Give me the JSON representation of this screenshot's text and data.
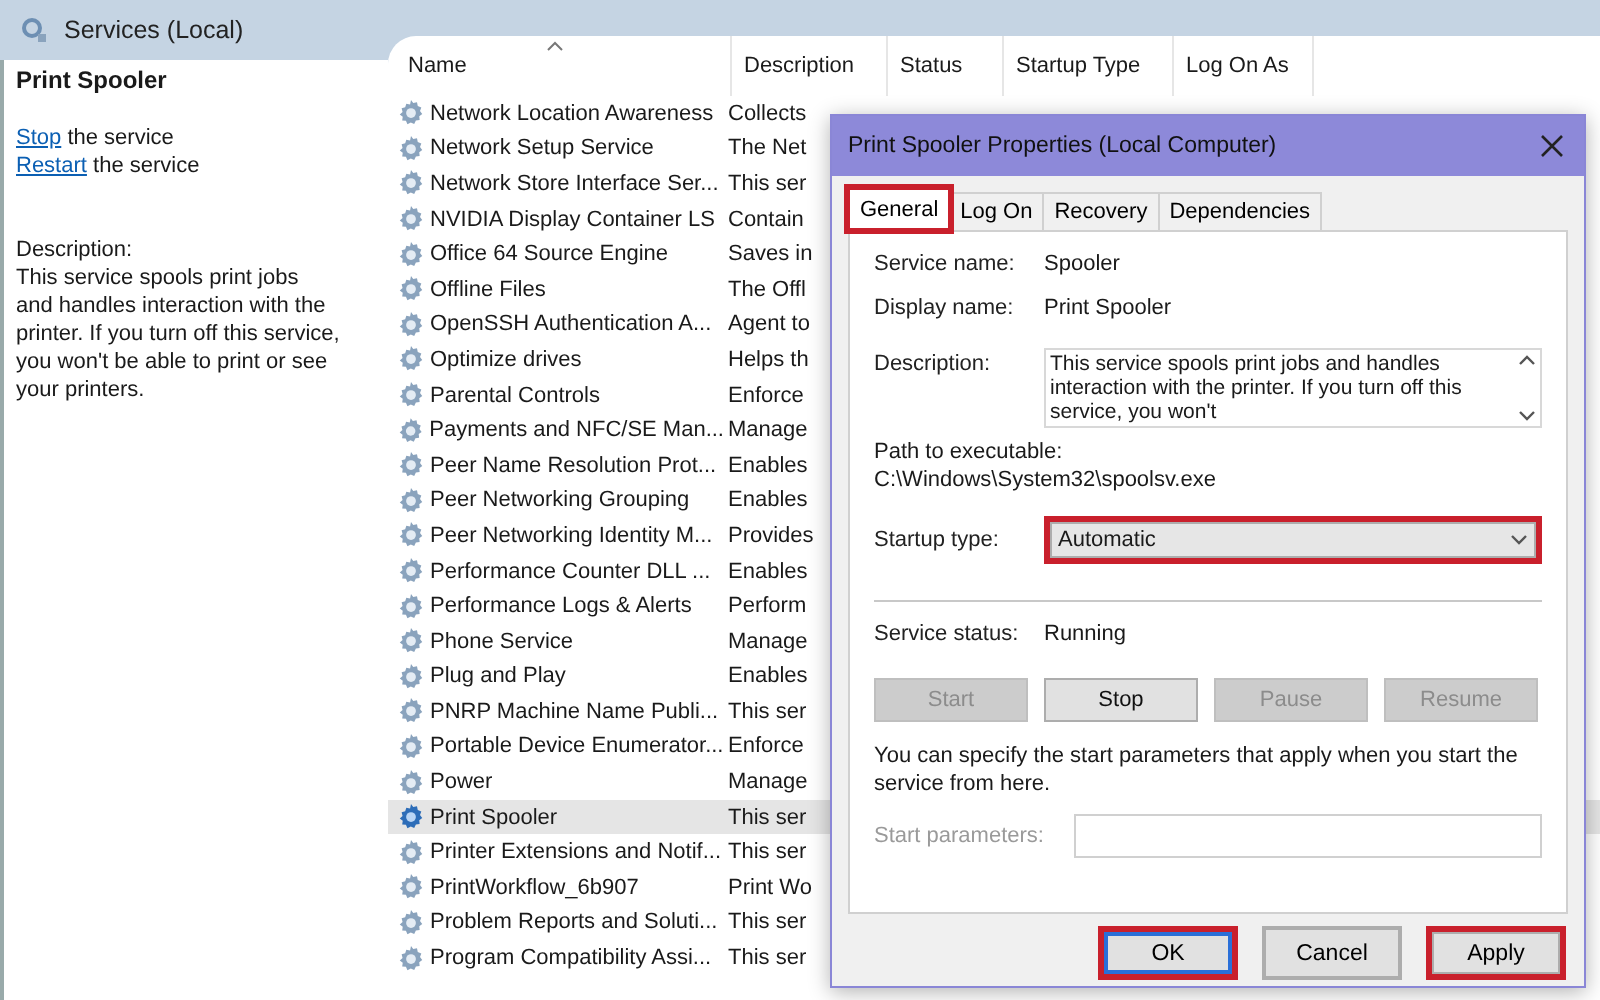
{
  "header": {
    "title": "Services (Local)"
  },
  "details": {
    "title": "Print Spooler",
    "actions": [
      {
        "link": "Stop",
        "text": "the service"
      },
      {
        "link": "Restart",
        "text": "the service"
      }
    ],
    "description_label": "Description:",
    "description": "This service spools print jobs and handles interaction with the printer. If you turn off this service, you won't be able to print or see your printers."
  },
  "table": {
    "columns": [
      {
        "label": "Name",
        "sorted": true
      },
      {
        "label": "Description",
        "sorted": false
      },
      {
        "label": "Status",
        "sorted": false
      },
      {
        "label": "Startup Type",
        "sorted": false
      },
      {
        "label": "Log On As",
        "sorted": false
      }
    ],
    "rows": [
      {
        "name": "Network Location Awareness",
        "description": "Collects",
        "selected": false
      },
      {
        "name": "Network Setup Service",
        "description": "The Net",
        "selected": false
      },
      {
        "name": "Network Store Interface Ser...",
        "description": "This ser",
        "selected": false
      },
      {
        "name": "NVIDIA Display Container LS",
        "description": "Contain",
        "selected": false
      },
      {
        "name": "Office 64 Source Engine",
        "description": "Saves in",
        "selected": false
      },
      {
        "name": "Offline Files",
        "description": "The Offl",
        "selected": false
      },
      {
        "name": "OpenSSH Authentication A...",
        "description": "Agent to",
        "selected": false
      },
      {
        "name": "Optimize drives",
        "description": "Helps th",
        "selected": false
      },
      {
        "name": "Parental Controls",
        "description": "Enforce",
        "selected": false
      },
      {
        "name": "Payments and NFC/SE Man...",
        "description": "Manage",
        "selected": false
      },
      {
        "name": "Peer Name Resolution Prot...",
        "description": "Enables",
        "selected": false
      },
      {
        "name": "Peer Networking Grouping",
        "description": "Enables",
        "selected": false
      },
      {
        "name": "Peer Networking Identity M...",
        "description": "Provides",
        "selected": false
      },
      {
        "name": "Performance Counter DLL ...",
        "description": "Enables",
        "selected": false
      },
      {
        "name": "Performance Logs & Alerts",
        "description": "Perform",
        "selected": false
      },
      {
        "name": "Phone Service",
        "description": "Manage",
        "selected": false
      },
      {
        "name": "Plug and Play",
        "description": "Enables",
        "selected": false
      },
      {
        "name": "PNRP Machine Name Publi...",
        "description": "This ser",
        "selected": false
      },
      {
        "name": "Portable Device Enumerator...",
        "description": "Enforce",
        "selected": false
      },
      {
        "name": "Power",
        "description": "Manage",
        "selected": false
      },
      {
        "name": "Print Spooler",
        "description": "This ser",
        "selected": true
      },
      {
        "name": "Printer Extensions and Notif...",
        "description": "This ser",
        "selected": false
      },
      {
        "name": "PrintWorkflow_6b907",
        "description": "Print Wo",
        "selected": false
      },
      {
        "name": "Problem Reports and Soluti...",
        "description": "This ser",
        "selected": false
      },
      {
        "name": "Program Compatibility Assi...",
        "description": "This ser",
        "selected": false
      }
    ]
  },
  "dialog": {
    "title": "Print Spooler Properties (Local Computer)",
    "tabs": [
      {
        "label": "General",
        "selected": true,
        "highlighted": true
      },
      {
        "label": "Log On",
        "selected": false,
        "highlighted": false
      },
      {
        "label": "Recovery",
        "selected": false,
        "highlighted": false
      },
      {
        "label": "Dependencies",
        "selected": false,
        "highlighted": false
      }
    ],
    "service_name_label": "Service name:",
    "service_name": "Spooler",
    "display_name_label": "Display name:",
    "display_name": "Print Spooler",
    "description_label": "Description:",
    "description": "This service spools print jobs and handles interaction with the printer.  If you turn off this service, you won't",
    "path_label": "Path to executable:",
    "path": "C:\\Windows\\System32\\spoolsv.exe",
    "startup_label": "Startup type:",
    "startup_value": "Automatic",
    "startup_highlighted": true,
    "status_label": "Service status:",
    "status": "Running",
    "control_buttons": [
      {
        "label": "Start",
        "disabled": true
      },
      {
        "label": "Stop",
        "disabled": false
      },
      {
        "label": "Pause",
        "disabled": true
      },
      {
        "label": "Resume",
        "disabled": true
      }
    ],
    "hint": "You can specify the start parameters that apply when you start the service from here.",
    "params_label": "Start parameters:",
    "params_disabled": true,
    "buttons": [
      {
        "label": "OK",
        "default": true,
        "highlighted": true
      },
      {
        "label": "Cancel",
        "default": false,
        "highlighted": false
      },
      {
        "label": "Apply",
        "default": false,
        "highlighted": true
      }
    ]
  }
}
